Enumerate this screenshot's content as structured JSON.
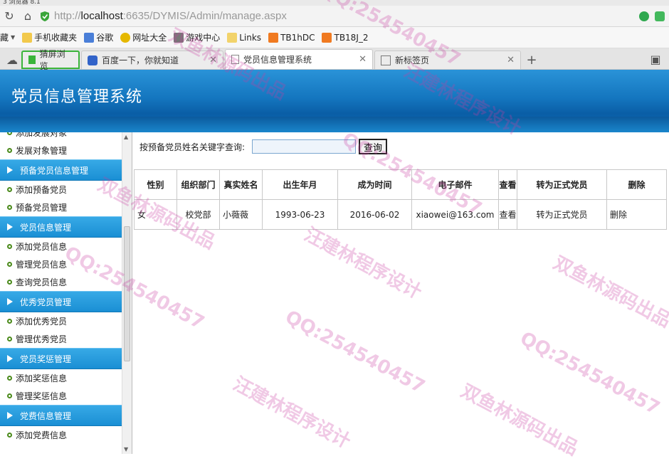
{
  "browser": {
    "title": "3 浏览器 8.1",
    "url_prefix": "http://",
    "url_host": "localhost",
    "url_rest": ":6635/DYMIS/Admin/manage.aspx",
    "bookmarks": [
      "藏",
      "手机收藏夹",
      "谷歌",
      "网址大全",
      "游戏中心",
      "Links",
      "TB1hDC",
      "TB18J_2"
    ],
    "tabs": [
      {
        "label": "猜屏浏览",
        "active": false
      },
      {
        "label": "百度一下，你就知道",
        "active": false
      },
      {
        "label": "党员信息管理系统",
        "active": true
      },
      {
        "label": "新标签页",
        "active": false
      }
    ],
    "new_tab_symbol": "+"
  },
  "app": {
    "title": "党员信息管理系统"
  },
  "sidebar": {
    "items": [
      {
        "type": "item",
        "label": "添加发展对象"
      },
      {
        "type": "item",
        "label": "发展对象管理"
      },
      {
        "type": "head",
        "label": "预备党员信息管理"
      },
      {
        "type": "item",
        "label": "添加预备党员"
      },
      {
        "type": "item",
        "label": "预备党员管理"
      },
      {
        "type": "head",
        "label": "党员信息管理"
      },
      {
        "type": "item",
        "label": "添加党员信息"
      },
      {
        "type": "item",
        "label": "管理党员信息"
      },
      {
        "type": "item",
        "label": "查询党员信息"
      },
      {
        "type": "head",
        "label": "优秀党员管理"
      },
      {
        "type": "item",
        "label": "添加优秀党员"
      },
      {
        "type": "item",
        "label": "管理优秀党员"
      },
      {
        "type": "head",
        "label": "党员奖惩管理"
      },
      {
        "type": "item",
        "label": "添加奖惩信息"
      },
      {
        "type": "item",
        "label": "管理奖惩信息"
      },
      {
        "type": "head",
        "label": "党费信息管理"
      },
      {
        "type": "item",
        "label": "添加党费信息"
      }
    ]
  },
  "search": {
    "label": "按预备党员姓名关键字查询:",
    "value": "",
    "button": "查询"
  },
  "table": {
    "headers": [
      "性别",
      "组织部门",
      "真实姓名",
      "出生年月",
      "成为时间",
      "电子邮件",
      "查看",
      "转为正式党员",
      "删除"
    ],
    "rows": [
      [
        "女",
        "校党部",
        "小薇薇",
        "1993-06-23",
        "2016-06-02",
        "xiaowei@163.com",
        "查看",
        "转为正式党员",
        "删除"
      ]
    ]
  },
  "watermark": {
    "qq": "QQ:254540457",
    "a": "双鱼林源码出品",
    "b": "汪建林程序设计"
  }
}
